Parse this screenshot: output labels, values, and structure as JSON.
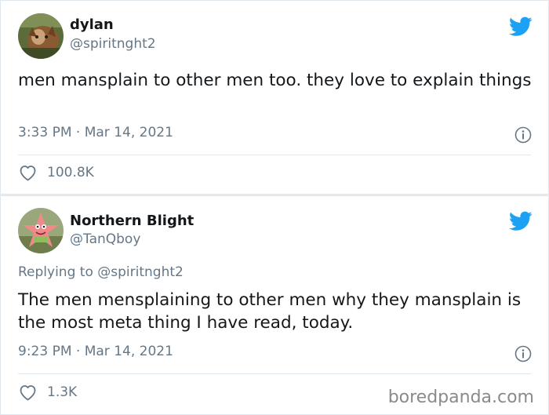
{
  "tweets": [
    {
      "display_name": "dylan",
      "handle": "@spiritnght2",
      "text": "men mansplain to other men too. they love to explain things",
      "timestamp": "3:33 PM · Mar 14, 2021",
      "likes": "100.8K",
      "avatar_icon": "avatar-cat-photo",
      "brand_icon": "twitter-bird-icon"
    },
    {
      "display_name": "Northern Blight",
      "handle": "@TanQboy",
      "replying_prefix": "Replying to",
      "replying_to": "@spiritnght2",
      "text": "The men mensplaining to other men why they mansplain is the most meta thing I have read, today.",
      "timestamp": "9:23 PM · Mar 14, 2021",
      "likes": "1.3K",
      "avatar_icon": "avatar-patrick-star-photo",
      "brand_icon": "twitter-bird-icon"
    }
  ],
  "watermark": "boredpanda.com",
  "colors": {
    "twitter_blue": "#1da1f2",
    "secondary_text": "#657786",
    "primary_text": "#14171a",
    "border": "#e1e8ed"
  }
}
